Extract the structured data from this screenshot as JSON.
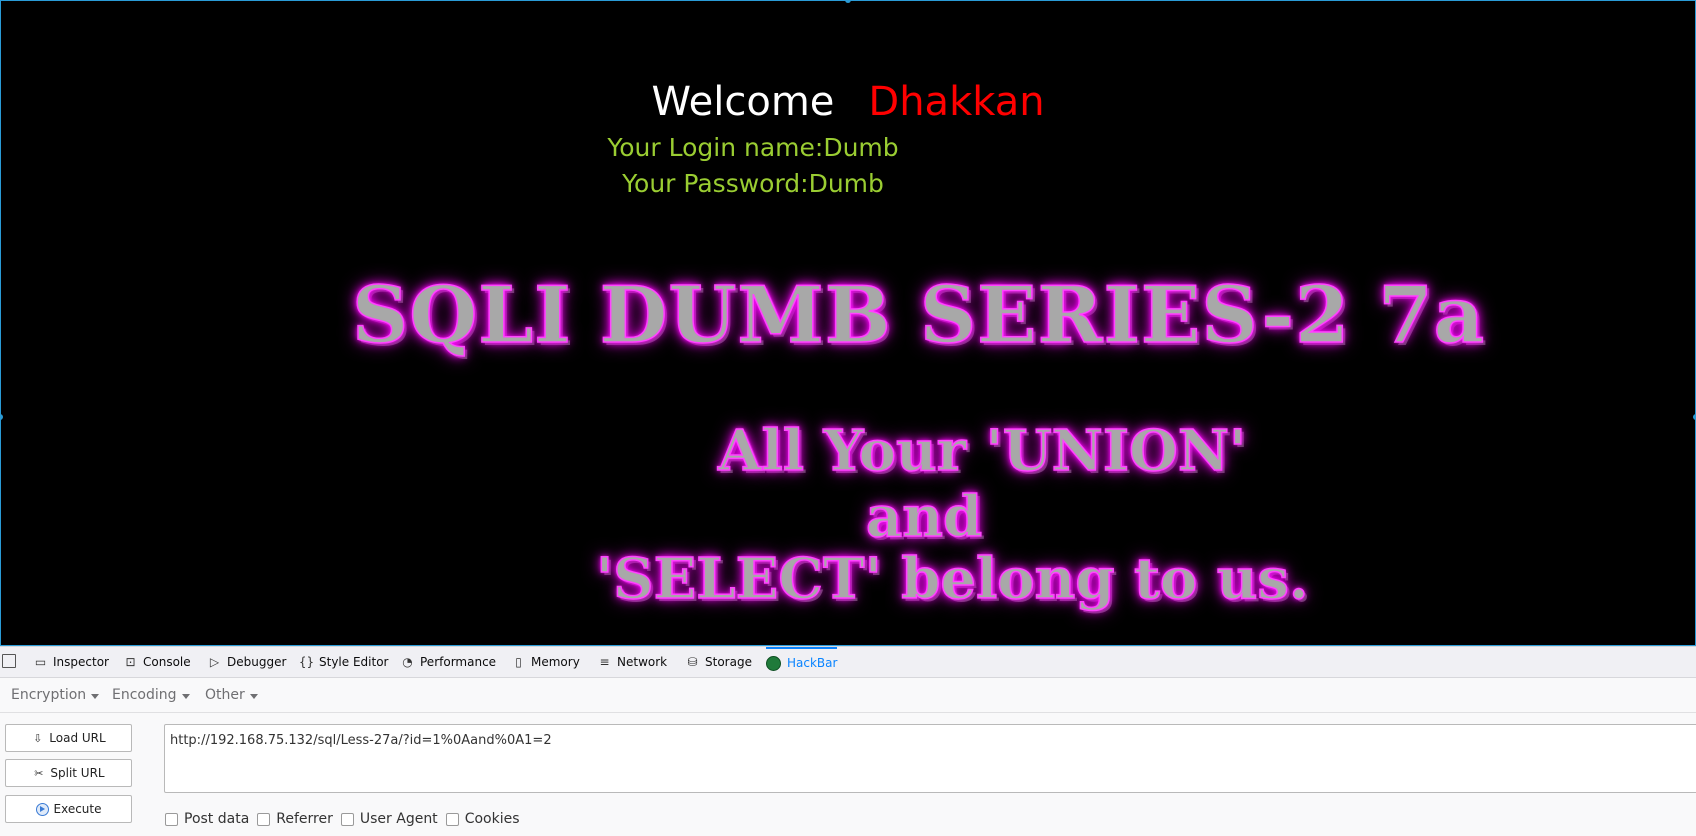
{
  "page": {
    "welcome": "Welcome",
    "user": "Dhakkan",
    "login_line": "Your Login name:Dumb",
    "password_line": "Your Password:Dumb",
    "title": "SQLI DUMB SERIES-2 7a",
    "motto": [
      "All Your 'UNION'",
      "and",
      "'SELECT' belong to us."
    ]
  },
  "devtools": {
    "tabs": [
      {
        "label": "Inspector",
        "icon": "inspector-icon"
      },
      {
        "label": "Console",
        "icon": "console-icon"
      },
      {
        "label": "Debugger",
        "icon": "debugger-icon"
      },
      {
        "label": "Style Editor",
        "icon": "style-editor-icon"
      },
      {
        "label": "Performance",
        "icon": "performance-icon"
      },
      {
        "label": "Memory",
        "icon": "memory-icon"
      },
      {
        "label": "Network",
        "icon": "network-icon"
      },
      {
        "label": "Storage",
        "icon": "storage-icon"
      },
      {
        "label": "HackBar",
        "icon": "hackbar-icon",
        "active": true
      }
    ]
  },
  "hackbar": {
    "menus": [
      "Encryption",
      "Encoding",
      "Other"
    ],
    "load_label": "Load URL",
    "split_label": "Split URL",
    "execute_label": "Execute",
    "url": "http://192.168.75.132/sql/Less-27a/?id=1%0Aand%0A1=2",
    "options": [
      "Post data",
      "Referrer",
      "User Agent",
      "Cookies"
    ]
  },
  "colors": {
    "accent": "#0a84ff",
    "welcome_name": "#ff0000",
    "credentials": "#9acd32",
    "banner_glow": "#ff00ff"
  }
}
